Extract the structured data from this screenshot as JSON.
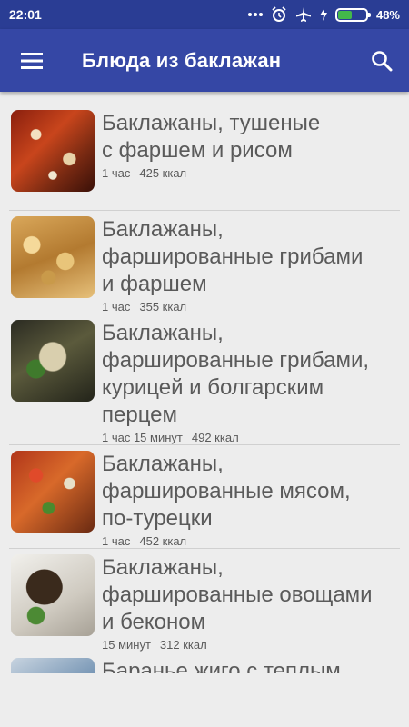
{
  "status_bar": {
    "time": "22:01",
    "battery_percent": "48%",
    "battery_level": 0.48,
    "icons": [
      "dots-icon",
      "alarm-icon",
      "airplane-mode-icon",
      "charging-icon",
      "battery-icon"
    ]
  },
  "app_bar": {
    "title": "Блюда из баклажан",
    "menu_icon": "hamburger-menu-icon",
    "search_icon": "search-icon",
    "color": "#3547a5",
    "status_color": "#2a3d94"
  },
  "recipes": [
    {
      "title_lines": [
        "Баклажаны, тушеные",
        "с фаршем и рисом"
      ],
      "time": "1 час",
      "kcal": "425 ккал"
    },
    {
      "title_lines": [
        "Баклажаны,",
        "фаршированные грибами",
        "и фаршем"
      ],
      "time": "1 час",
      "kcal": "355 ккал"
    },
    {
      "title_lines": [
        "Баклажаны,",
        "фаршированные грибами,",
        "курицей и болгарским",
        "перцем"
      ],
      "time": "1 час 15 минут",
      "kcal": "492 ккал"
    },
    {
      "title_lines": [
        "Баклажаны,",
        "фаршированные мясом,",
        "по-турецки"
      ],
      "time": "1 час",
      "kcal": "452 ккал"
    },
    {
      "title_lines": [
        "Баклажаны,",
        "фаршированные овощами",
        "и беконом"
      ],
      "time": "15 минут",
      "kcal": "312 ккал"
    },
    {
      "title_lines": [
        "Баранье жиго с теплым"
      ],
      "time": "",
      "kcal": ""
    }
  ]
}
